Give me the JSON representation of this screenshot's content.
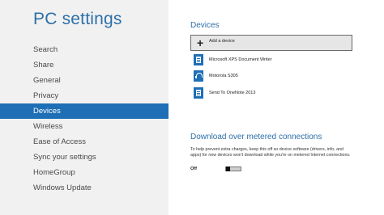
{
  "sidebar": {
    "title": "PC settings",
    "items": [
      {
        "label": "Search"
      },
      {
        "label": "Share"
      },
      {
        "label": "General"
      },
      {
        "label": "Privacy"
      },
      {
        "label": "Devices",
        "selected": true
      },
      {
        "label": "Wireless"
      },
      {
        "label": "Ease of Access"
      },
      {
        "label": "Sync your settings"
      },
      {
        "label": "HomeGroup"
      },
      {
        "label": "Windows Update"
      }
    ]
  },
  "devices": {
    "title": "Devices",
    "add_label": "Add a device",
    "add_icon": "plus-icon",
    "list": [
      {
        "name": "Microsoft XPS Document Writer",
        "icon": "document-icon"
      },
      {
        "name": "Motorola S305",
        "icon": "headset-icon"
      },
      {
        "name": "Send To OneNote 2013",
        "icon": "document-icon"
      }
    ]
  },
  "metered": {
    "title": "Download over metered connections",
    "description": "To help prevent extra charges, keep this off so device software (drivers, info, and apps) for new devices won't download while you're on metered Internet connections.",
    "toggle_label": "Off",
    "toggle_state": "off"
  },
  "colors": {
    "accent": "#1e6fb5",
    "title": "#2d6fa8",
    "sidebar_bg": "#f1f1f1"
  }
}
